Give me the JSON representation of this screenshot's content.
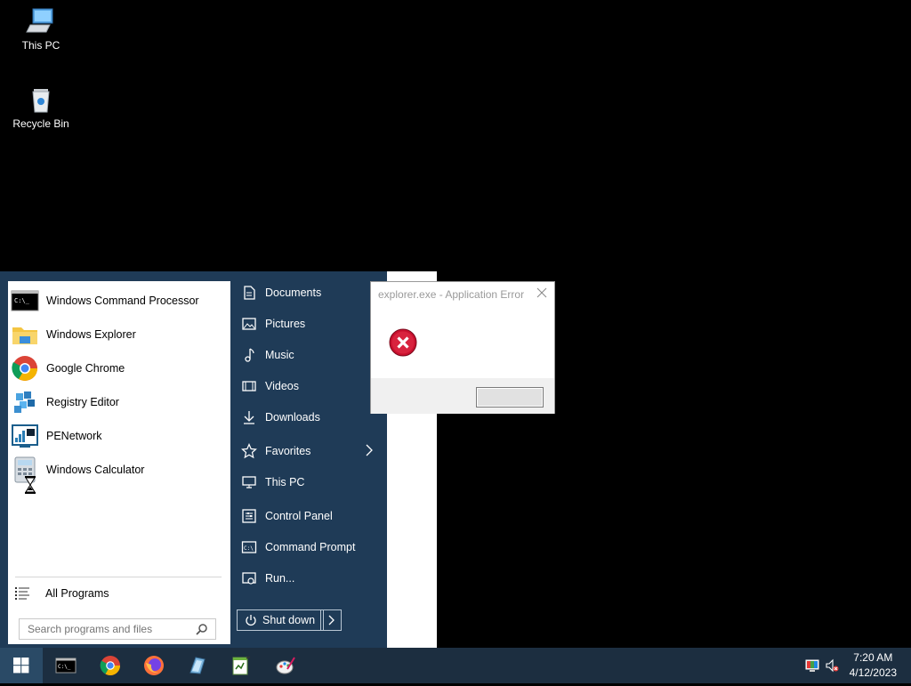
{
  "desktop": {
    "icons": [
      {
        "label": "This PC"
      },
      {
        "label": "Recycle Bin"
      }
    ]
  },
  "start_menu": {
    "apps": [
      {
        "label": "Windows Command Processor",
        "icon": "cmd-icon"
      },
      {
        "label": "Windows Explorer",
        "icon": "folder-icon"
      },
      {
        "label": "Google Chrome",
        "icon": "chrome-icon"
      },
      {
        "label": "Registry Editor",
        "icon": "registry-icon"
      },
      {
        "label": "PENetwork",
        "icon": "network-icon"
      },
      {
        "label": "Windows Calculator",
        "icon": "calculator-icon"
      }
    ],
    "all_programs": "All Programs",
    "search_placeholder": "Search programs and files",
    "places": [
      {
        "label": "Documents"
      },
      {
        "label": "Pictures"
      },
      {
        "label": "Music"
      },
      {
        "label": "Videos"
      },
      {
        "label": "Downloads"
      },
      {
        "label": "Favorites"
      },
      {
        "label": "This PC"
      },
      {
        "label": "Control Panel"
      },
      {
        "label": "Command Prompt"
      },
      {
        "label": "Run..."
      }
    ],
    "shutdown_label": "Shut down"
  },
  "dialog": {
    "title": "explorer.exe - Application Error"
  },
  "taskbar": {
    "time": "7:20 AM",
    "date": "4/12/2023"
  },
  "colors": {
    "menu_bg": "#1f3b57",
    "taskbar_bg": "#1c2e40",
    "error_red": "#c8102e"
  }
}
